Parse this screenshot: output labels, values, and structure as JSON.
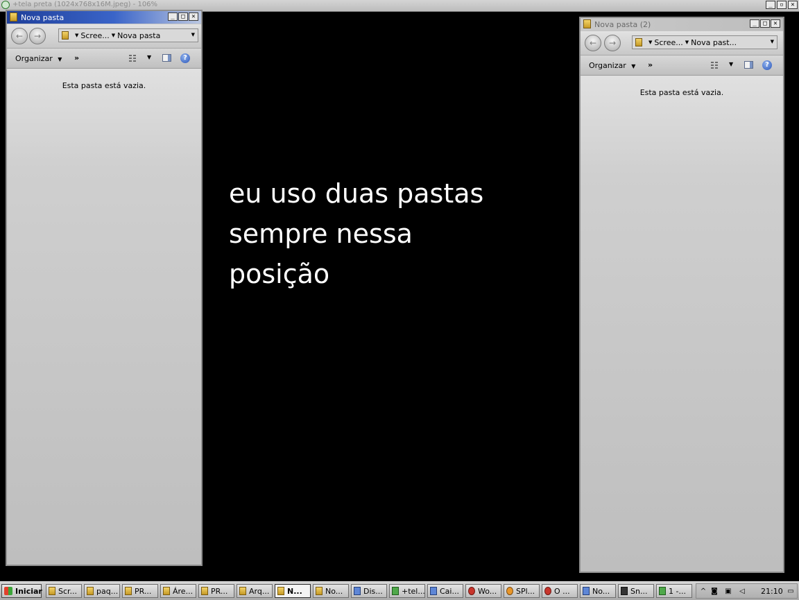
{
  "viewer": {
    "title": "+tela preta (1024x768x16M.jpeg) - 106%",
    "buttons": [
      "_",
      "▫",
      "✕"
    ]
  },
  "window_left": {
    "title": "Nova pasta",
    "breadcrumb": [
      "Scree...",
      "Nova pasta"
    ],
    "toolbar": {
      "organize": "Organizar",
      "more": "»"
    },
    "empty_message": "Esta pasta está vazia."
  },
  "window_right": {
    "title": "Nova pasta (2)",
    "breadcrumb": [
      "Scree...",
      "Nova past..."
    ],
    "toolbar": {
      "organize": "Organizar",
      "more": "»"
    },
    "empty_message": "Esta pasta está vazia."
  },
  "caption": {
    "lines": [
      "eu uso duas pastas",
      "sempre nessa",
      "posição"
    ]
  },
  "taskbar": {
    "start_label": "Iniciar",
    "tasks": [
      {
        "label": "Scr...",
        "icon": "folder-icon"
      },
      {
        "label": "paq...",
        "icon": "folder-icon"
      },
      {
        "label": "PR...",
        "icon": "folder-icon"
      },
      {
        "label": "Áre...",
        "icon": "folder-icon"
      },
      {
        "label": "PR...",
        "icon": "folder-icon"
      },
      {
        "label": "Arq...",
        "icon": "folder-icon"
      },
      {
        "label": "N...",
        "icon": "folder-icon"
      },
      {
        "label": "No...",
        "icon": "folder-icon"
      },
      {
        "label": "Dis...",
        "icon": "app-icon"
      },
      {
        "label": "+tel...",
        "icon": "viewer-icon"
      },
      {
        "label": "Cai...",
        "icon": "mail-icon"
      },
      {
        "label": "Wo...",
        "icon": "app-icon"
      },
      {
        "label": "SPl...",
        "icon": "app-icon"
      },
      {
        "label": "O ...",
        "icon": "browser-icon"
      },
      {
        "label": "No...",
        "icon": "app-icon"
      },
      {
        "label": "Sn...",
        "icon": "camera-icon"
      },
      {
        "label": "1 -...",
        "icon": "app-icon"
      }
    ],
    "clock": "21:10"
  }
}
